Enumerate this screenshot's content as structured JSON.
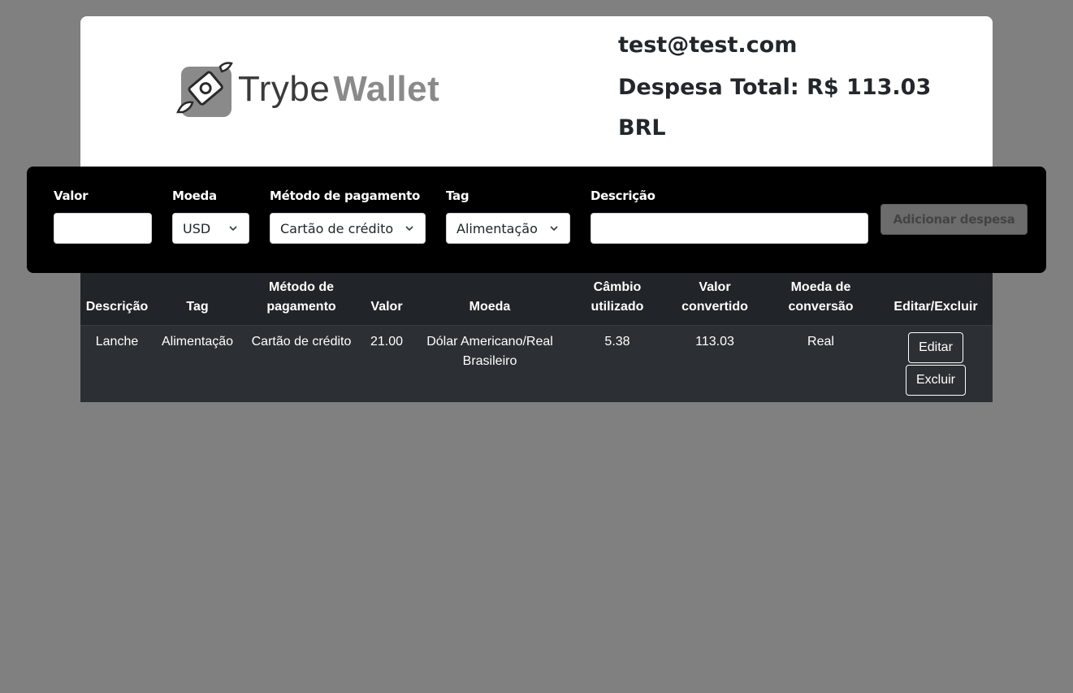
{
  "header": {
    "logo_text_1": "Trybe",
    "logo_text_2": "Wallet",
    "email": "test@test.com",
    "total_label": "Despesa Total: R$ 113.03",
    "currency": "BRL"
  },
  "form": {
    "value_label": "Valor",
    "value_input": "",
    "currency_label": "Moeda",
    "currency_selected": "USD",
    "method_label": "Método de pagamento",
    "method_selected": "Cartão de crédito",
    "tag_label": "Tag",
    "tag_selected": "Alimentação",
    "description_label": "Descrição",
    "description_input": "",
    "add_button": "Adicionar despesa"
  },
  "table": {
    "headers": [
      "Descrição",
      "Tag",
      "Método de pagamento",
      "Valor",
      "Moeda",
      "Câmbio utilizado",
      "Valor convertido",
      "Moeda de conversão",
      "Editar/Excluir"
    ],
    "rows": [
      {
        "description": "Lanche",
        "tag": "Alimentação",
        "method": "Cartão de crédito",
        "value": "21.00",
        "currency": "Dólar Americano/Real Brasileiro",
        "rate": "5.38",
        "converted": "113.03",
        "conversion_currency": "Real",
        "edit_label": "Editar",
        "delete_label": "Excluir"
      }
    ]
  },
  "colors": {
    "background": "#808080",
    "form_bar": "#000000",
    "table_bg": "#212529",
    "button_disabled": "#6c6c6c"
  }
}
